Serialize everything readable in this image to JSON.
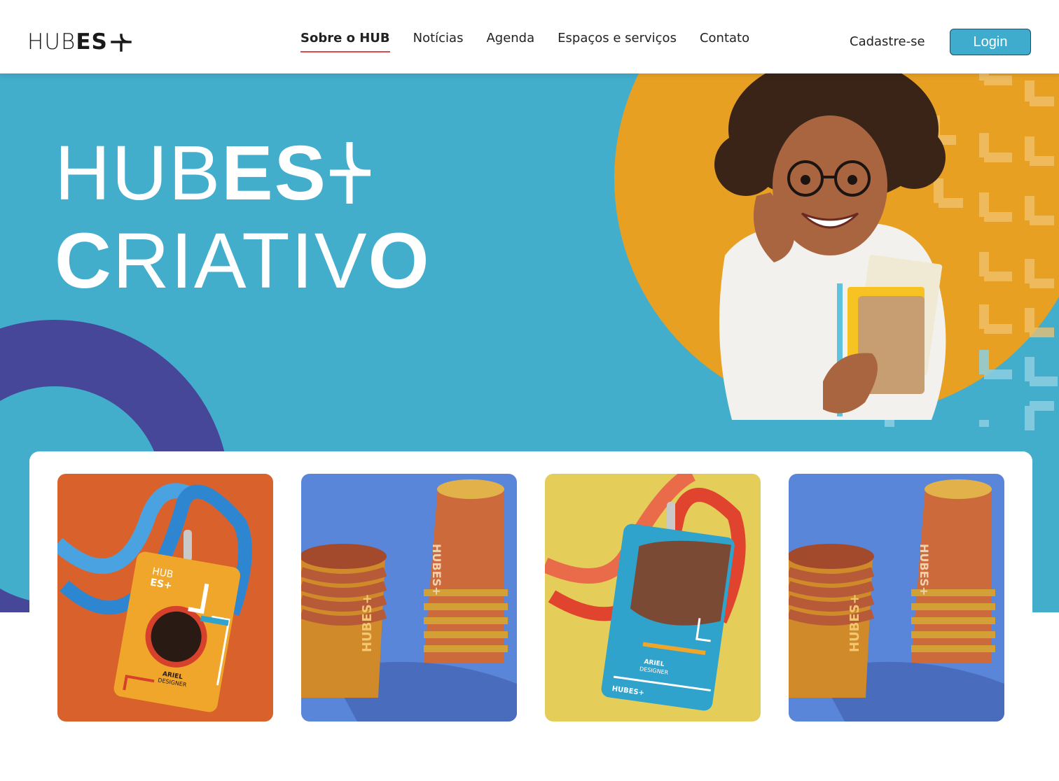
{
  "header": {
    "logo": {
      "thin": "HUB",
      "bold": "ES"
    },
    "nav": [
      {
        "label": "Sobre o HUB",
        "active": true
      },
      {
        "label": "Notícias",
        "active": false
      },
      {
        "label": "Agenda",
        "active": false
      },
      {
        "label": "Espaços e serviços",
        "active": false
      },
      {
        "label": "Contato",
        "active": false
      }
    ],
    "signup_label": "Cadastre-se",
    "login_label": "Login"
  },
  "hero": {
    "line1_thin": "HUB",
    "line1_bold": "ES",
    "line2": {
      "c": "C",
      "mid": "RIATIV",
      "o": "O"
    }
  },
  "gallery": {
    "badge1": {
      "brand_thin": "HUB",
      "brand_bold": "ES+",
      "name": "ARIEL",
      "role": "DESIGNER"
    },
    "badge2": {
      "name": "ARIEL",
      "role": "DESIGNER",
      "brand": "HUBES+"
    },
    "cup_brand": "HUBES+"
  },
  "colors": {
    "hero_blue": "#43adcc",
    "orange": "#e8a023",
    "purple": "#474799",
    "login_button": "#3fabcd",
    "nav_active_underline": "#e0494b",
    "tile1_bg": "#d9622c",
    "tile2_bg": "#5a86d9",
    "tile3_bg": "#e5cd5a",
    "tile4_bg": "#5a86d9"
  }
}
